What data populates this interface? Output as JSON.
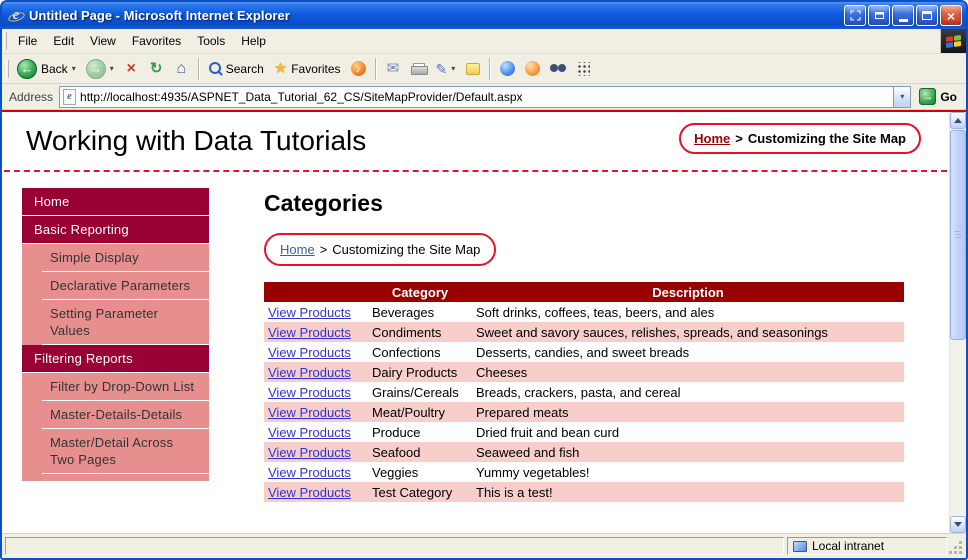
{
  "window": {
    "title": "Untitled Page - Microsoft Internet Explorer",
    "menu": [
      "File",
      "Edit",
      "View",
      "Favorites",
      "Tools",
      "Help"
    ],
    "toolbar": {
      "back": "Back",
      "search": "Search",
      "favorites": "Favorites"
    },
    "address": {
      "label": "Address",
      "url": "http://localhost:4935/ASPNET_Data_Tutorial_62_CS/SiteMapProvider/Default.aspx",
      "go": "Go"
    },
    "status_zone": "Local intranet"
  },
  "page": {
    "title": "Working with Data Tutorials",
    "header_breadcrumb": {
      "home": "Home",
      "separator": ">",
      "current": "Customizing the Site Map"
    },
    "content": {
      "heading": "Categories",
      "breadcrumb": {
        "home": "Home",
        "separator": ">",
        "current": "Customizing the Site Map"
      }
    }
  },
  "sidebar": {
    "items": [
      {
        "label": "Home",
        "level": 0
      },
      {
        "label": "Basic Reporting",
        "level": 0
      },
      {
        "label": "Simple Display",
        "level": 1
      },
      {
        "label": "Declarative Parameters",
        "level": 1
      },
      {
        "label": "Setting Parameter Values",
        "level": 1
      },
      {
        "label": "Filtering Reports",
        "level": 0
      },
      {
        "label": "Filter by Drop-Down List",
        "level": 1
      },
      {
        "label": "Master-Details-Details",
        "level": 1
      },
      {
        "label": "Master/Detail Across Two Pages",
        "level": 1
      }
    ]
  },
  "table": {
    "link_text": "View Products",
    "headers": {
      "empty": "",
      "category": "Category",
      "description": "Description"
    },
    "rows": [
      {
        "category": "Beverages",
        "description": "Soft drinks, coffees, teas, beers, and ales"
      },
      {
        "category": "Condiments",
        "description": "Sweet and savory sauces, relishes, spreads, and seasonings"
      },
      {
        "category": "Confections",
        "description": "Desserts, candies, and sweet breads"
      },
      {
        "category": "Dairy Products",
        "description": "Cheeses"
      },
      {
        "category": "Grains/Cereals",
        "description": "Breads, crackers, pasta, and cereal"
      },
      {
        "category": "Meat/Poultry",
        "description": "Prepared meats"
      },
      {
        "category": "Produce",
        "description": "Dried fruit and bean curd"
      },
      {
        "category": "Seafood",
        "description": "Seaweed and fish"
      },
      {
        "category": "Veggies",
        "description": "Yummy vegetables!"
      },
      {
        "category": "Test Category",
        "description": "This is a test!"
      }
    ]
  },
  "colors": {
    "titlebar_blue": "#0D5BE0",
    "sidebar_dark": "#990033",
    "sidebar_light": "#E78F8F",
    "table_header_red": "#990000",
    "row_pink": "#F8CECB",
    "link_blue": "#3333CC",
    "annotation_red": "#E8112D"
  }
}
